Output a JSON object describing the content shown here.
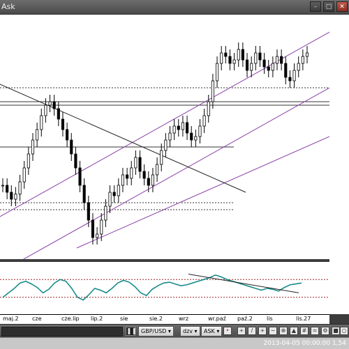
{
  "window": {
    "title": "Ask",
    "min_icon": "minimize-icon",
    "max_icon": "maximize-icon",
    "close_icon": "close-icon"
  },
  "colors": {
    "bull_candle": "#ffffff",
    "bear_candle": "#000000",
    "channel_line": "#8a3fa6",
    "indicator_line": "#1a8a8a",
    "background": "#ffffff",
    "chrome": "#4a4a4a"
  },
  "toolbar": {
    "instrument": "GBP/USD",
    "period": "dzv",
    "side": "ASK",
    "scroll_icon": "pause-icon"
  },
  "status": {
    "text": "2013-04-05 00:00:00 1,54"
  },
  "chart_data": [
    {
      "type": "line",
      "title": "",
      "instrument": "GBP/USD",
      "side": "ASK",
      "x_tick_labels": [
        "maj.2",
        "cze",
        "cze.lip",
        "lip.2",
        "sie",
        "sie.2",
        "wrz",
        "wr.paź",
        "paź.2",
        "lis",
        "lis.27"
      ],
      "series": [
        {
          "values": [
            0.4,
            0.36,
            0.32,
            0.35,
            0.42,
            0.5,
            0.58,
            0.66,
            0.72,
            0.8,
            0.86,
            0.88,
            0.84,
            0.78,
            0.72,
            0.66,
            0.58,
            0.5,
            0.4,
            0.3,
            0.2,
            0.1,
            0.12,
            0.2,
            0.28,
            0.36,
            0.34,
            0.4,
            0.46,
            0.44,
            0.5,
            0.56,
            0.48,
            0.44,
            0.4,
            0.46,
            0.52,
            0.6,
            0.66,
            0.7,
            0.74,
            0.72,
            0.76,
            0.7,
            0.66,
            0.68,
            0.74,
            0.8,
            0.88,
            1.0,
            1.1,
            1.16,
            1.14,
            1.1,
            1.12,
            1.18,
            1.12,
            1.06,
            1.1,
            1.16,
            1.12,
            1.08,
            1.06,
            1.1,
            1.14,
            1.1,
            1.02,
            1.0,
            1.06,
            1.1,
            1.14,
            1.16
          ]
        }
      ],
      "horizontal_levels": [
        0.96,
        0.88,
        0.86,
        0.62,
        0.3,
        0.26
      ],
      "channel_lines": 3,
      "trend_lines": 1
    },
    {
      "type": "line",
      "title": "",
      "subplot": "oscillator",
      "series": [
        {
          "values": [
            0.3,
            0.4,
            0.5,
            0.62,
            0.66,
            0.6,
            0.52,
            0.4,
            0.48,
            0.62,
            0.7,
            0.66,
            0.5,
            0.3,
            0.24,
            0.36,
            0.5,
            0.46,
            0.4,
            0.5,
            0.62,
            0.68,
            0.64,
            0.54,
            0.4,
            0.34,
            0.48,
            0.56,
            0.62,
            0.64,
            0.6,
            0.56,
            0.58,
            0.62,
            0.66,
            0.7,
            0.74,
            0.8,
            0.76,
            0.7,
            0.66,
            0.62,
            0.58,
            0.54,
            0.5,
            0.46,
            0.5,
            0.48,
            0.44,
            0.52,
            0.58,
            0.6,
            0.62
          ]
        }
      ],
      "levels": [
        0.7,
        0.3
      ]
    }
  ]
}
